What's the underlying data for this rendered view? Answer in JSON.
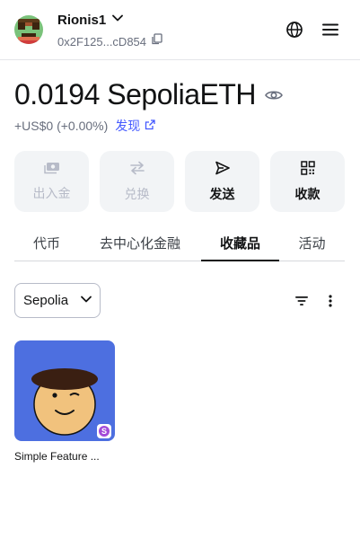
{
  "account": {
    "name": "Rionis1",
    "address": "0x2F125...cD854"
  },
  "icons": {
    "avatar": "pixel-avatar-icon",
    "chevron": "chevron-down-icon",
    "copy": "copy-icon",
    "globe": "globe-icon",
    "menu": "hamburger-menu-icon",
    "eye": "eye-icon",
    "external": "external-link-icon"
  },
  "balance": {
    "amount": "0.0194",
    "unit": "SepoliaETH",
    "fiat": "+US$0 (+0.00%)",
    "discover_label": "发现"
  },
  "actions": [
    {
      "label": "出入金",
      "icon": "bank-note-icon",
      "enabled": false
    },
    {
      "label": "兑换",
      "icon": "swap-arrows-icon",
      "enabled": false
    },
    {
      "label": "发送",
      "icon": "send-arrow-icon",
      "enabled": true
    },
    {
      "label": "收款",
      "icon": "qr-code-icon",
      "enabled": true
    }
  ],
  "tabs": [
    {
      "label": "代币",
      "active": false
    },
    {
      "label": "去中心化金融",
      "active": false
    },
    {
      "label": "收藏品",
      "active": true
    },
    {
      "label": "活动",
      "active": false
    }
  ],
  "filters": {
    "network": "Sepolia"
  },
  "nfts": [
    {
      "name": "Simple Feature ...",
      "badge": "S"
    }
  ],
  "colors": {
    "accent": "#4459ff",
    "nft_bg": "#4d6fe0",
    "badge": "#a34bd8",
    "muted": "#686e7d"
  }
}
